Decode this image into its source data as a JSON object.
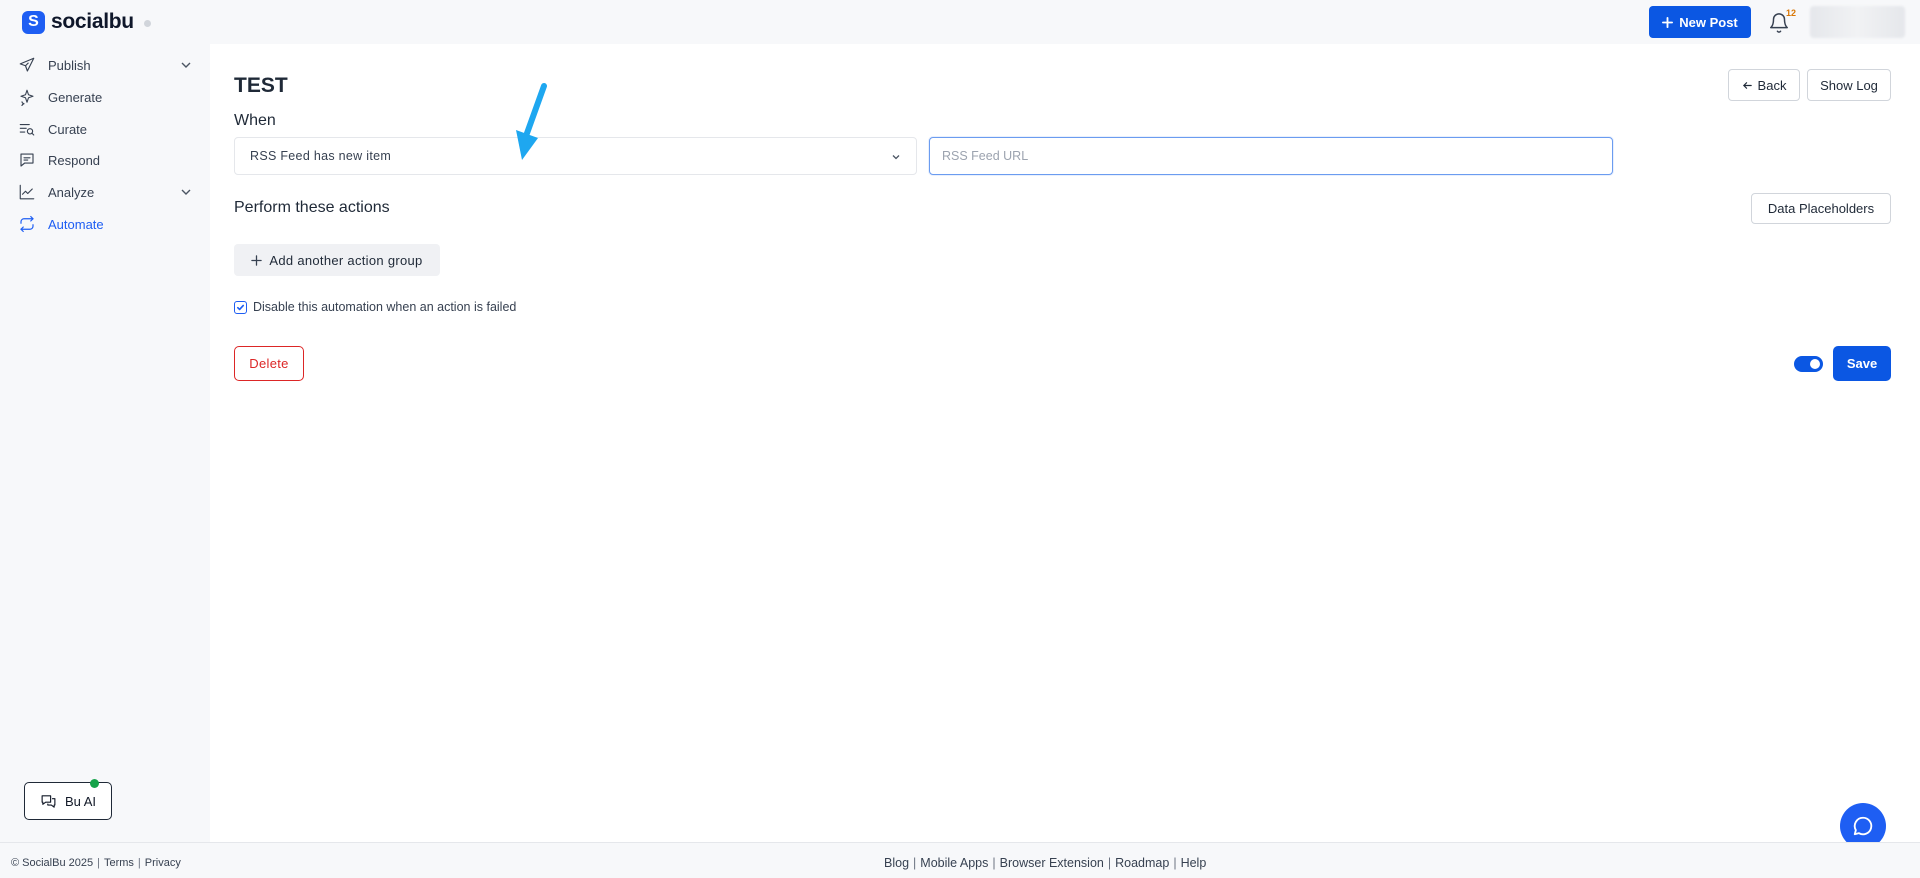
{
  "brand": {
    "name": "socialbu",
    "mark": "S"
  },
  "header": {
    "new_post_label": "New Post",
    "notification_count": "12"
  },
  "sidebar": {
    "items": [
      {
        "label": "Publish",
        "icon": "send-icon",
        "expandable": true
      },
      {
        "label": "Generate",
        "icon": "sparkle-icon",
        "expandable": false
      },
      {
        "label": "Curate",
        "icon": "curate-icon",
        "expandable": false
      },
      {
        "label": "Respond",
        "icon": "message-icon",
        "expandable": false
      },
      {
        "label": "Analyze",
        "icon": "chart-line-icon",
        "expandable": true
      },
      {
        "label": "Automate",
        "icon": "repeat-icon",
        "expandable": false,
        "active": true
      }
    ],
    "bu_ai_label": "Bu AI"
  },
  "main": {
    "title": "TEST",
    "when_label": "When",
    "trigger_value": "RSS Feed has new item",
    "rss_placeholder": "RSS Feed URL",
    "back_label": "Back",
    "show_log_label": "Show Log",
    "perform_label": "Perform these actions",
    "data_placeholders_label": "Data Placeholders",
    "add_group_label": "Add another action group",
    "disable_label": "Disable this automation when an action is failed",
    "disable_checked": true,
    "delete_label": "Delete",
    "enabled": true,
    "save_label": "Save"
  },
  "footer": {
    "copyright": "© SocialBu 2025",
    "left_links": [
      "Terms",
      "Privacy"
    ],
    "center_links": [
      "Blog",
      "Mobile Apps",
      "Browser Extension",
      "Roadmap",
      "Help"
    ]
  },
  "colors": {
    "primary": "#0b57e3",
    "danger": "#dc2626",
    "annotation_arrow": "#1ea7f0"
  }
}
